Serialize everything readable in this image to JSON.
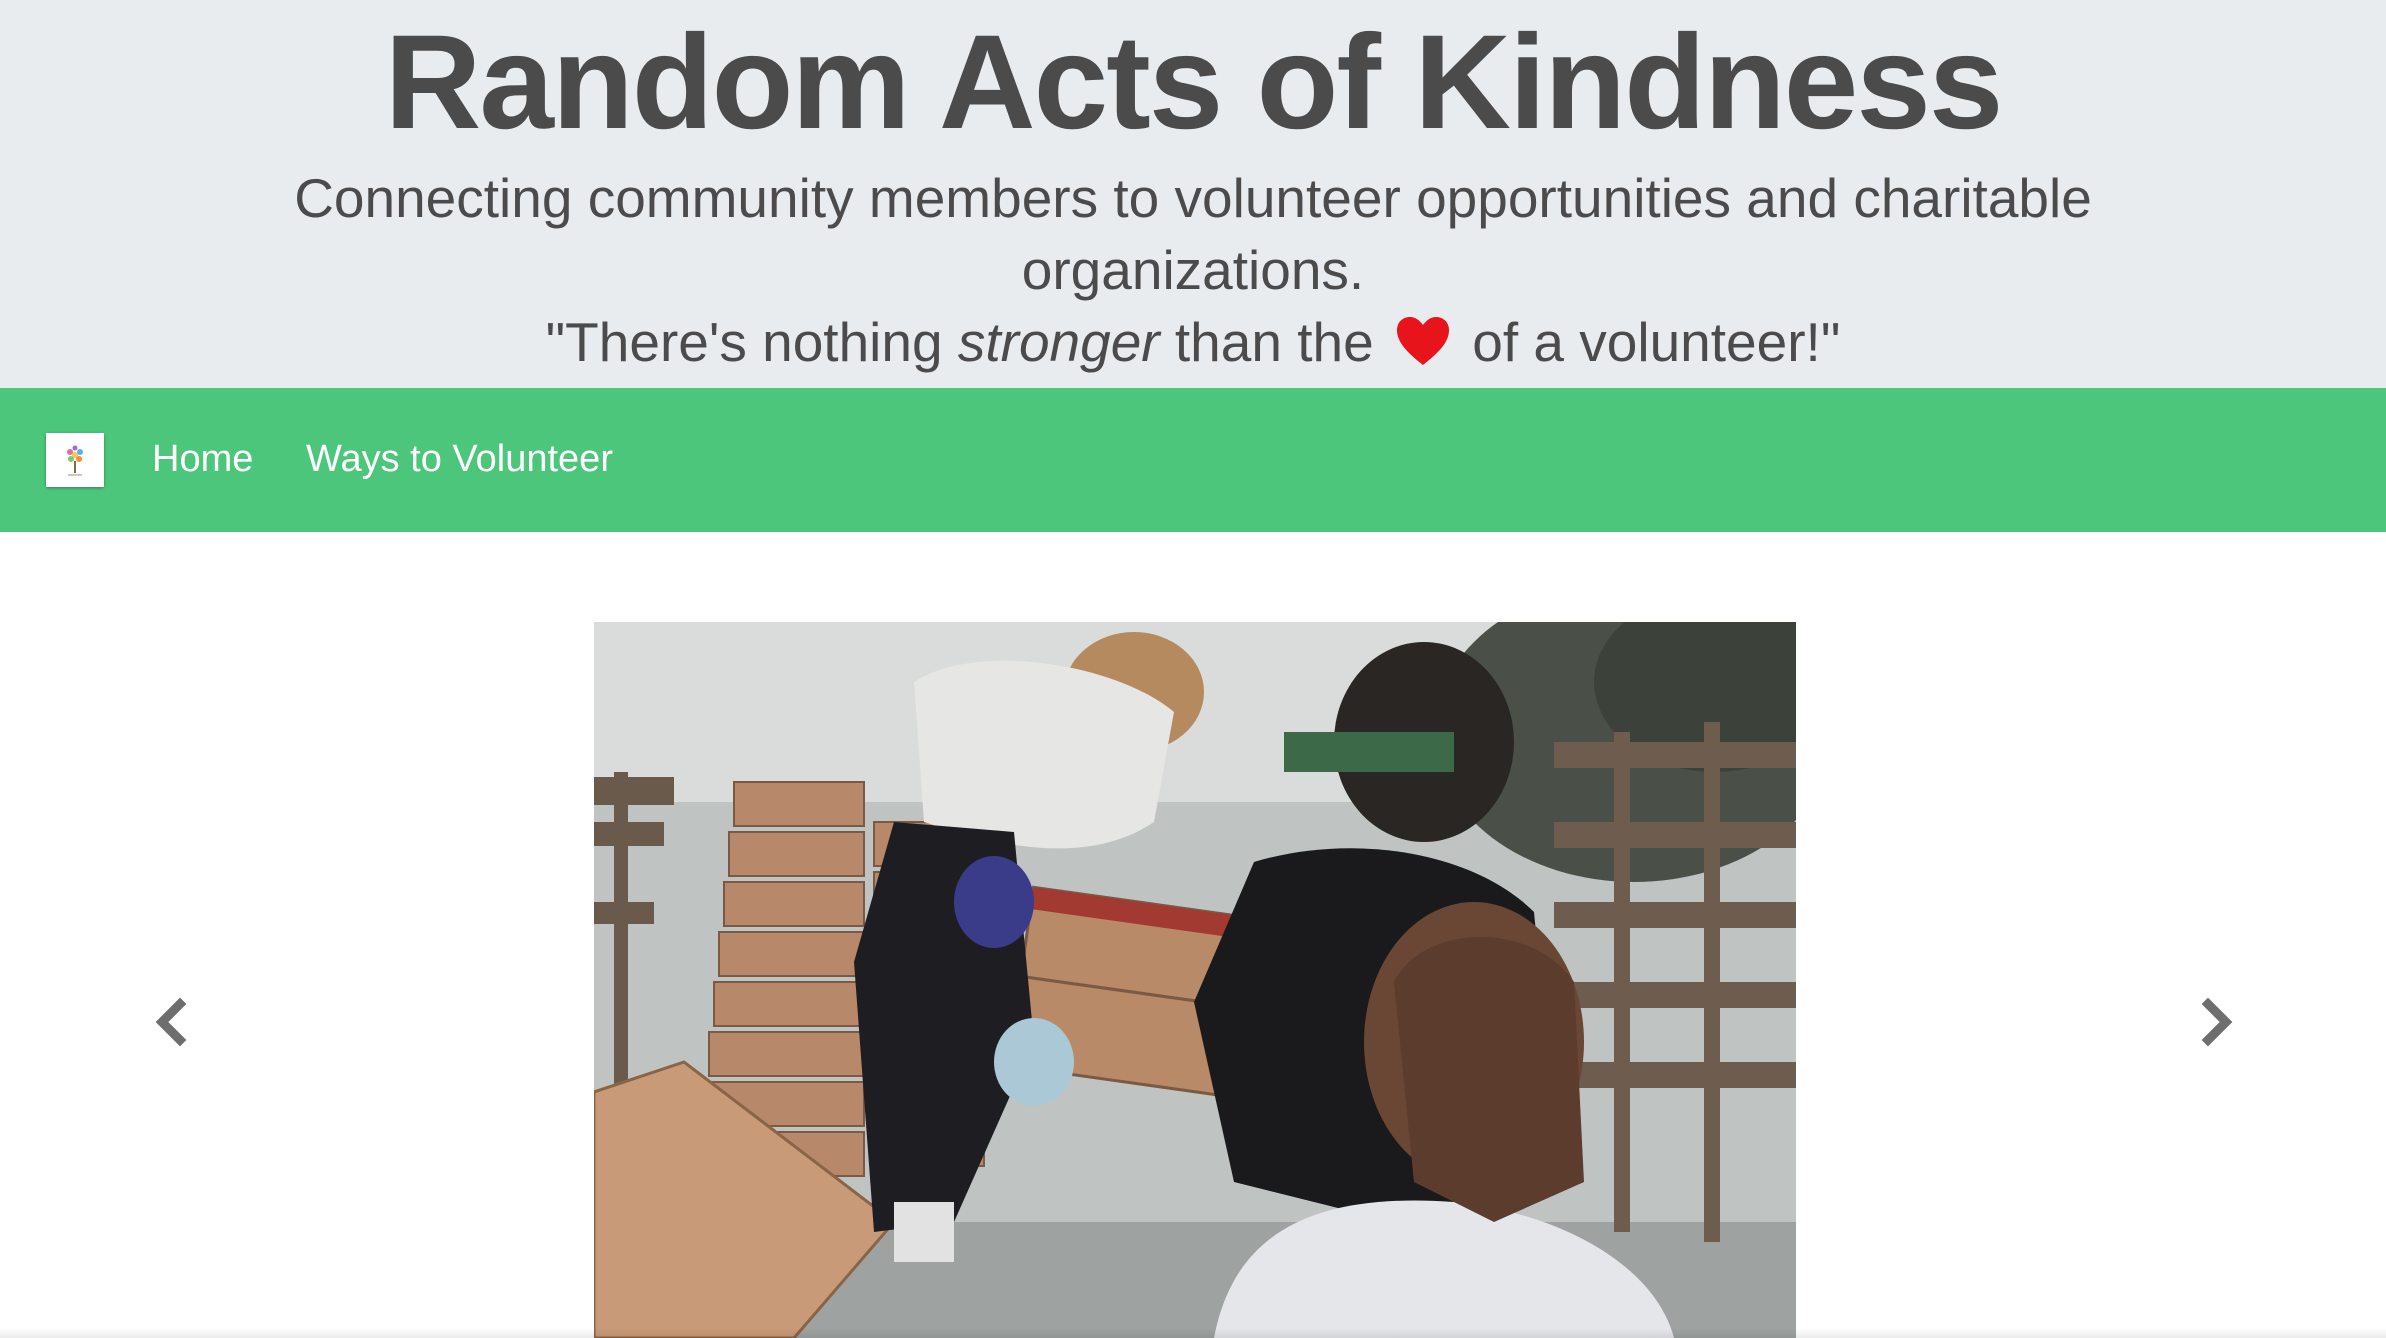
{
  "hero": {
    "title": "Random Acts of Kindness",
    "tagline": "Connecting community members to volunteer opportunities and charitable organizations.",
    "quote_before": "\"There's nothing ",
    "quote_emphasis": "stronger",
    "quote_middle": " than the",
    "quote_icon": "heart-icon",
    "quote_after": " of a volunteer!\"",
    "heart_color": "#e8141b"
  },
  "navbar": {
    "background": "#4cc67a",
    "logo_icon": "tree-logo-icon",
    "links": [
      {
        "label": "Home"
      },
      {
        "label": "Ways to Volunteer"
      }
    ]
  },
  "carousel": {
    "slide_image": "volunteers-unloading-produce-boxes-photo",
    "prev_icon": "chevron-left-icon",
    "next_icon": "chevron-right-icon"
  }
}
